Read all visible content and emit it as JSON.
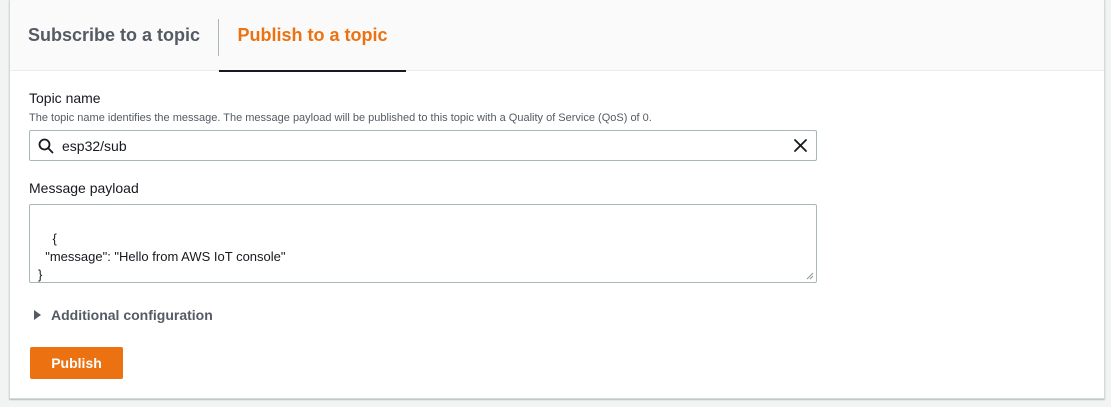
{
  "tabs": [
    {
      "label": "Subscribe to a topic",
      "active": false
    },
    {
      "label": "Publish to a topic",
      "active": true
    }
  ],
  "topic": {
    "label": "Topic name",
    "description": "The topic name identifies the message. The message payload will be published to this topic with a Quality of Service (QoS) of 0.",
    "value": "esp32/sub",
    "search_icon": "search-icon",
    "clear_icon": "close-icon"
  },
  "payload": {
    "label": "Message payload",
    "value": "{\n  \"message\": \"Hello from AWS IoT console\"\n}"
  },
  "additional": {
    "label": "Additional configuration",
    "icon": "caret-right-icon"
  },
  "publish": {
    "label": "Publish"
  },
  "colors": {
    "accent": "#ec7211",
    "text": "#16191f",
    "muted": "#545b64",
    "border": "#aab7b8"
  }
}
